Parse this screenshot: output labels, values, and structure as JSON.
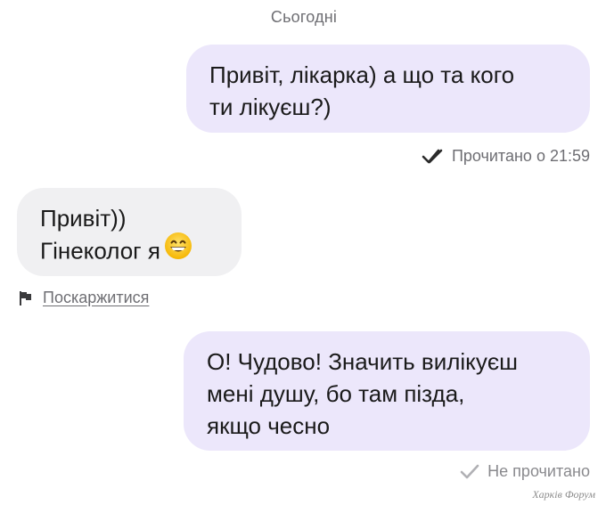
{
  "chat": {
    "date_separator": "Сьогодні",
    "messages": [
      {
        "direction": "outgoing",
        "lines": [
          "Привіт, лікарка) а що та кого",
          "ти лікуєш?)"
        ],
        "status": "Прочитано о 21:59",
        "status_icon": "double-check-icon"
      },
      {
        "direction": "incoming",
        "lines": [
          "Привіт))",
          "Гінеколог я"
        ],
        "emoji": "grinning-face-icon",
        "report_label": "Поскаржитися",
        "report_icon": "flag-icon"
      },
      {
        "direction": "outgoing",
        "lines": [
          "О! Чудово! Значить вилікуєш",
          "мені душу, бо там пізда,",
          "якщо чесно"
        ],
        "status": "Не прочитано",
        "status_icon": "single-check-icon"
      }
    ]
  },
  "watermark": "Харків Форум",
  "colors": {
    "outgoing_bubble": "#ece7fb",
    "incoming_bubble": "#f0f0f2",
    "meta_text": "#6e6e73"
  }
}
